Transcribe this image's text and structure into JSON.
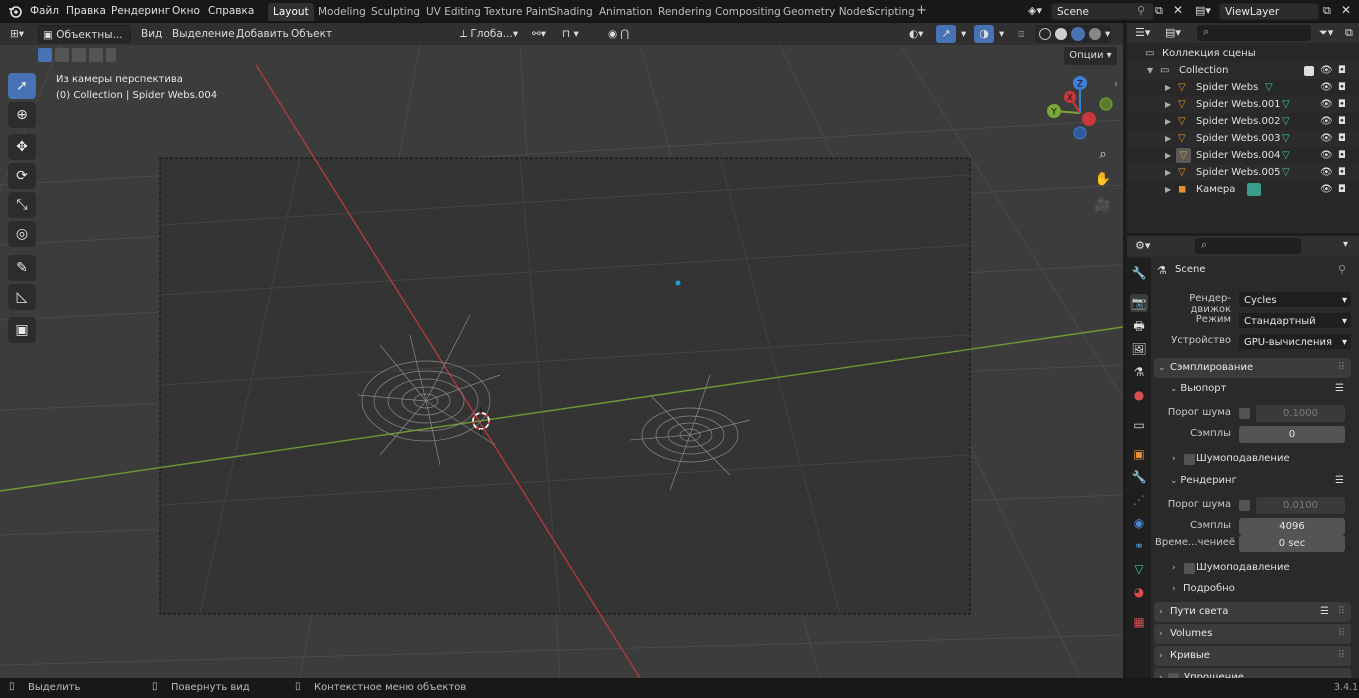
{
  "topbar": {
    "menus": [
      "Файл",
      "Правка",
      "Рендеринг",
      "Окно",
      "Справка"
    ],
    "workspaces": [
      "Layout",
      "Modeling",
      "Sculpting",
      "UV Editing",
      "Texture Paint",
      "Shading",
      "Animation",
      "Rendering",
      "Compositing",
      "Geometry Nodes",
      "Scripting"
    ],
    "active_workspace": "Layout",
    "add_tab": "+",
    "scene_name": "Scene",
    "view_layer": "ViewLayer"
  },
  "viewport_header": {
    "mode": "Объектны...",
    "menus": [
      "Вид",
      "Выделение",
      "Добавить",
      "Объект"
    ],
    "transform_orientation": "Глоба...",
    "options": "Опции"
  },
  "viewport": {
    "view_name": "Из камеры перспектива",
    "context": "(0) Collection | Spider Webs.004",
    "gizmo_labels": {
      "z": "Z",
      "y": "Y",
      "x": "X"
    }
  },
  "tools": [
    {
      "name": "select-box-tool",
      "glyph": "⬚"
    },
    {
      "name": "cursor-tool",
      "glyph": "⊕"
    },
    {
      "name": "move-tool",
      "glyph": "✥"
    },
    {
      "name": "rotate-tool",
      "glyph": "⟳"
    },
    {
      "name": "scale-tool",
      "glyph": "⤡"
    },
    {
      "name": "transform-tool",
      "glyph": "◎"
    },
    {
      "name": "annotate-tool",
      "glyph": "✎"
    },
    {
      "name": "measure-tool",
      "glyph": "📐"
    },
    {
      "name": "add-cube-tool",
      "glyph": "▣"
    }
  ],
  "outliner": {
    "scene_collection": "Коллекция сцены",
    "collection": "Collection",
    "items": [
      "Spider Webs",
      "Spider Webs.001",
      "Spider Webs.002",
      "Spider Webs.003",
      "Spider Webs.004",
      "Spider Webs.005",
      "Камера"
    ]
  },
  "properties": {
    "scene": "Scene",
    "render_engine_label": "Рендер-движок",
    "render_engine": "Cycles",
    "mode_label": "Режим",
    "mode": "Стандартный",
    "device_label": "Устройство",
    "device": "GPU-вычисления",
    "sampling": "Сэмплирование",
    "viewport": "Вьюпорт",
    "noise_threshold_label": "Порог шума",
    "viewport_noise_threshold": "0.1000",
    "samples_label": "Сэмплы",
    "viewport_samples": "0",
    "denoise": "Шумоподавление",
    "render": "Рендеринг",
    "render_noise_threshold": "0.0100",
    "render_samples": "4096",
    "time_limit_label": "Време...чениеё",
    "time_limit": "0 sec",
    "advanced": "Подробно",
    "light_paths": "Пути света",
    "volumes": "Volumes",
    "curves": "Кривые",
    "simplify": "Упрощение"
  },
  "statusbar": {
    "select": "Выделить",
    "rotate_view": "Повернуть вид",
    "context_menu": "Контекстное меню объектов",
    "version": "3.4.1"
  },
  "colors": {
    "accent": "#4772b3",
    "x_axis": "#c8383c",
    "y_axis": "#7aa838",
    "z_axis": "#3d7fd6"
  }
}
